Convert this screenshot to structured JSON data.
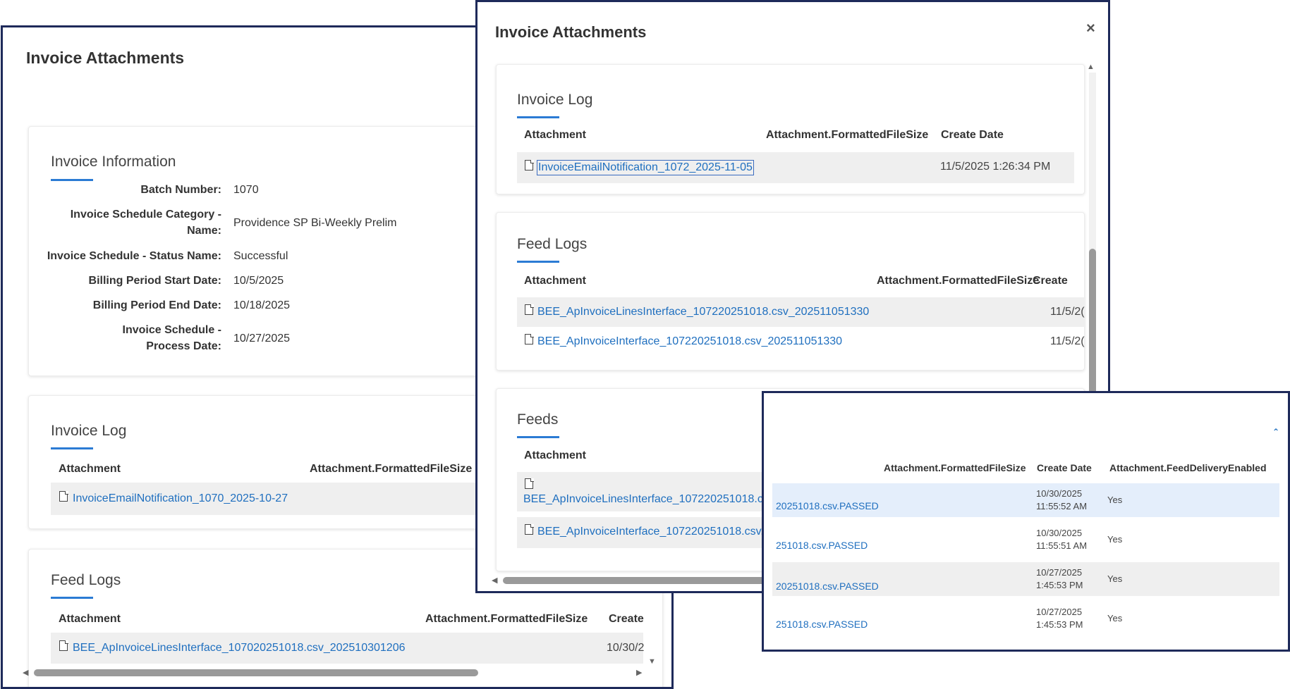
{
  "panel1": {
    "title": "Invoice Attachments",
    "info": {
      "title": "Invoice Information",
      "fields": [
        {
          "label": "Batch Number:",
          "value": "1070"
        },
        {
          "label": "Invoice Schedule Category - Name:",
          "value": "Providence SP Bi-Weekly Prelim"
        },
        {
          "label": "Invoice Schedule - Status Name:",
          "value": "Successful"
        },
        {
          "label": "Billing Period Start Date:",
          "value": "10/5/2025"
        },
        {
          "label": "Billing Period End Date:",
          "value": "10/18/2025"
        },
        {
          "label": "Invoice Schedule - Process Date:",
          "value": "10/27/2025"
        }
      ]
    },
    "invoice_log": {
      "title": "Invoice Log",
      "headers": [
        "Attachment",
        "Attachment.FormattedFileSize"
      ],
      "rows": [
        {
          "attachment": "InvoiceEmailNotification_1070_2025-10-27"
        }
      ]
    },
    "feed_logs": {
      "title": "Feed Logs",
      "headers": [
        "Attachment",
        "Attachment.FormattedFileSize",
        "Create"
      ],
      "rows": [
        {
          "attachment": "BEE_ApInvoiceLinesInterface_107020251018.csv_202510301206",
          "date": "10/30/2"
        }
      ]
    }
  },
  "panel2": {
    "title": "Invoice Attachments",
    "close": "×",
    "invoice_log": {
      "title": "Invoice Log",
      "headers": [
        "Attachment",
        "Attachment.FormattedFileSize",
        "Create Date"
      ],
      "rows": [
        {
          "attachment": "InvoiceEmailNotification_1072_2025-11-05",
          "date": "11/5/2025 1:26:34 PM"
        }
      ]
    },
    "feed_logs": {
      "title": "Feed Logs",
      "headers": [
        "Attachment",
        "Attachment.FormattedFileSize",
        "Create"
      ],
      "rows": [
        {
          "attachment": "BEE_ApInvoiceLinesInterface_107220251018.csv_202511051330",
          "date": "11/5/2("
        },
        {
          "attachment": "BEE_ApInvoiceInterface_107220251018.csv_202511051330",
          "date": "11/5/2("
        }
      ]
    },
    "feeds": {
      "title": "Feeds",
      "headers": [
        "Attachment"
      ],
      "rows": [
        {
          "attachment": "BEE_ApInvoiceLinesInterface_107220251018.csv"
        },
        {
          "attachment": "BEE_ApInvoiceInterface_107220251018.csv.P"
        }
      ]
    }
  },
  "panel3": {
    "headers": [
      "Attachment.FormattedFileSize",
      "Create Date",
      "Attachment.FeedDeliveryEnabled"
    ],
    "rows": [
      {
        "attachment": "20251018.csv.PASSED",
        "date1": "10/30/2025",
        "date2": "11:55:52 AM",
        "enabled": "Yes"
      },
      {
        "attachment": "251018.csv.PASSED",
        "date1": "10/30/2025",
        "date2": "11:55:51 AM",
        "enabled": "Yes"
      },
      {
        "attachment": "20251018.csv.PASSED",
        "date1": "10/27/2025",
        "date2": "1:45:53 PM",
        "enabled": "Yes"
      },
      {
        "attachment": "251018.csv.PASSED",
        "date1": "10/27/2025",
        "date2": "1:45:53 PM",
        "enabled": "Yes"
      }
    ]
  },
  "colors": {
    "border": "#1e2a5a",
    "link": "#1f6fbf",
    "accent": "#2b7bd4",
    "highlight": "#e4eefb"
  }
}
